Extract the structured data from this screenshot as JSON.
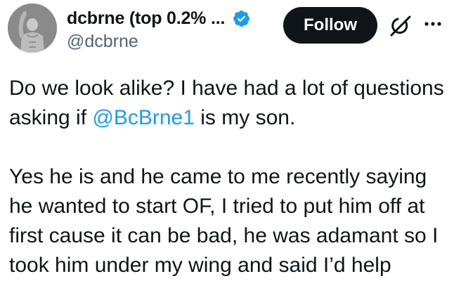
{
  "author": {
    "display_name": "dcbrne (top 0.2% ...",
    "handle": "@dcbrne",
    "verified_icon": "verified-badge-icon",
    "verified_color": "#1d9bf0"
  },
  "actions": {
    "follow_label": "Follow",
    "grok_icon": "grok-icon",
    "more_icon": "more-options-icon"
  },
  "tweet": {
    "p1_before": "Do we look alike? I have had a lot of questions asking if ",
    "p1_mention": "@BcBrne1",
    "p1_after": " is my son.",
    "p2": "Yes he is and he came to me recently saying he wanted to start OF, I tried to put him off at first cause it can be bad, he was adamant so I took him under my wing and said I’d help"
  },
  "colors": {
    "text": "#0f1419",
    "secondary": "#536471",
    "accent": "#1d9bf0",
    "button_bg": "#0f1419"
  }
}
